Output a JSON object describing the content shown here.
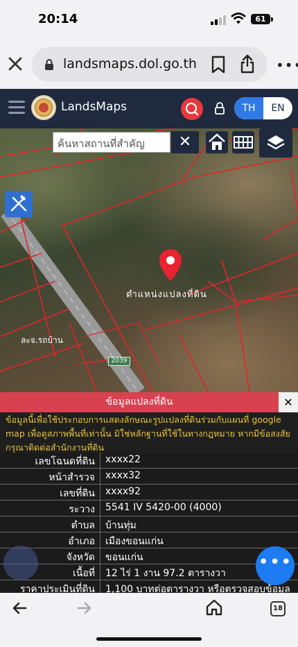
{
  "status_bar": {
    "time": "20:14",
    "battery": "61"
  },
  "browser": {
    "url": "landsmaps.dol.go.th"
  },
  "app": {
    "title": "LandsMaps",
    "lang_th": "TH",
    "lang_en": "EN"
  },
  "map": {
    "search_placeholder": "ค้นหาสถานที่สำคัญ",
    "clear_label": "✕",
    "parcel_label": "ตำแหน่งแปลงที่ดิน",
    "street_label": "ละจ.รถบ้าน",
    "road_number": "2039"
  },
  "info_panel": {
    "title": "ข้อมูลแปลงที่ดิน",
    "close_label": "✕",
    "disclaimer": "ข้อมูลนี้เพื่อใช้ประกอบการแสดงลักษณะรูปแปลงที่ดินร่วมกับแผนที่ google map เพื่อดูสภาพพื้นที่เท่านั้น มิใช่หลักฐานที่ใช้ในทางกฎหมาย หากมีข้อสงสัยกรุณาติดต่อสำนักงานที่ดิน",
    "rows": [
      {
        "label": "เลขโฉนดที่ดิน",
        "value": "xxxx22"
      },
      {
        "label": "หน้าสำรวจ",
        "value": "xxxx32"
      },
      {
        "label": "เลขที่ดิน",
        "value": "xxxx92"
      },
      {
        "label": "ระวาง",
        "value": "5541 IV 5420-00 (4000)"
      },
      {
        "label": "ตำบล",
        "value": "บ้านทุ่ม"
      },
      {
        "label": "อำเภอ",
        "value": "เมืองขอนแก่น"
      },
      {
        "label": "จังหวัด",
        "value": "ขอนแก่น"
      },
      {
        "label": "เนื้อที่",
        "value": "12 ไร่ 1 งาน 97.2 ตารางวา"
      },
      {
        "label": "ราคาประเมินที่ดิน",
        "value": "1,100 บาทต่อตารางวา หรือตรวจสอบข้อมูล"
      }
    ],
    "more_label": "•••"
  },
  "toolbar": {
    "tabs_count": "18"
  }
}
